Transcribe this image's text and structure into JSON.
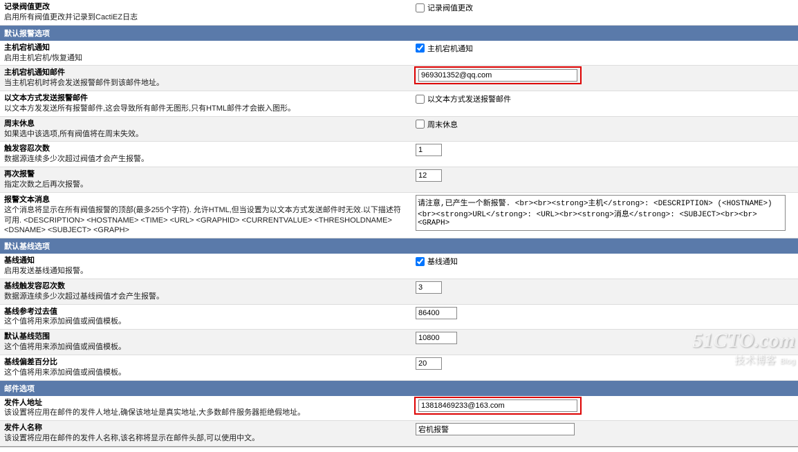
{
  "rows": {
    "log_title": "记录阀值更改",
    "log_desc": "启用所有阀值更改并记录到CactiEZ日志",
    "log_chk": "记录阀值更改",
    "log_checked": false
  },
  "sec_alert_header": "默认报警选项",
  "alert": {
    "host_title": "主机宕机通知",
    "host_desc": "启用主机宕机/恢复通知",
    "host_chk": "主机宕机通知",
    "host_checked": true,
    "email_title": "主机宕机通知邮件",
    "email_desc": "当主机宕机时将会发送报警邮件到该邮件地址。",
    "email_value": "969301352@qq.com",
    "text_title": "以文本方式发送报警邮件",
    "text_desc": "以文本方发发送所有报警邮件,这会导致所有邮件无图形,只有HTML邮件才会嵌入图形。",
    "text_chk": "以文本方式发送报警邮件",
    "text_checked": false,
    "weekend_title": "周末休息",
    "weekend_desc": "如果选中该选项,所有阀值将在周末失效。",
    "weekend_chk": "周末休息",
    "weekend_checked": false,
    "trigger_title": "触发容忍次数",
    "trigger_desc": "数据源连续多少次超过阀值才会产生报警。",
    "trigger_value": "1",
    "realert_title": "再次报警",
    "realert_desc": "指定次数之后再次报警。",
    "realert_value": "12",
    "msg_title": "报警文本消息",
    "msg_desc": "这个消息将显示在所有阀值报警的顶部(最多255个字符). 允许HTML,但当设置为以文本方式发送邮件时无效.以下描述符可用. <DESCRIPTION> <HOSTNAME> <TIME> <URL> <GRAPHID> <CURRENTVALUE> <THRESHOLDNAME> <DSNAME> <SUBJECT> <GRAPH>",
    "msg_value": "请注意,已产生一个新报警. <br><br><strong>主机</strong>: <DESCRIPTION> (<HOSTNAME>) <br><strong>URL</strong>: <URL><br><strong>消息</strong>: <SUBJECT><br><br><GRAPH>"
  },
  "sec_baseline_header": "默认基线选项",
  "baseline": {
    "notify_title": "基线通知",
    "notify_desc": "启用发送基线通知报警。",
    "notify_chk": "基线通知",
    "notify_checked": true,
    "trigger_title": "基线触发容忍次数",
    "trigger_desc": "数据源连续多少次超过基线阀值才会产生报警。",
    "trigger_value": "3",
    "past_title": "基线参考过去值",
    "past_desc": "这个值将用来添加阀值或阀值模板。",
    "past_value": "86400",
    "range_title": "默认基线范围",
    "range_desc": "这个值将用来添加阀值或阀值模板。",
    "range_value": "10800",
    "pct_title": "基线偏差百分比",
    "pct_desc": "这个值将用来添加阀值或阀值模板。",
    "pct_value": "20"
  },
  "sec_mail_header": "邮件选项",
  "mail": {
    "from_title": "发件人地址",
    "from_desc": "该设置将应用在邮件的发件人地址,确保该地址是真实地址,大多数邮件服务器拒绝假地址。",
    "from_value": "13818469233@163.com",
    "name_title": "发件人名称",
    "name_desc": "该设置将应用在邮件的发件人名称,该名称将显示在邮件头部,可以使用中文。",
    "name_value": "宕机报警"
  },
  "watermark": {
    "main": "51CTO.com",
    "sub": "技术博客",
    "sub2": "Blog"
  }
}
